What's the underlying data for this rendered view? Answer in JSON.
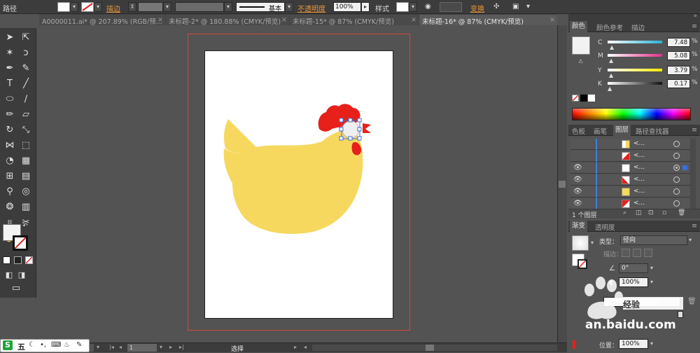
{
  "control_bar": {
    "selection_type": "路径",
    "stroke_label": "描边",
    "stroke_style": "基本",
    "opacity_label": "不透明度",
    "opacity_value": "100%",
    "style_label": "样式",
    "transform_label": "变换"
  },
  "tabs": [
    {
      "label": "A0000011.ai* @ 207.89% (RGB/预..."
    },
    {
      "label": "未标题-2* @ 180.88% (CMYK/预览)"
    },
    {
      "label": "未标题-15* @ 87% (CMYK/预览)"
    },
    {
      "label": "未标题-16* @ 87% (CMYK/预览)"
    }
  ],
  "color_panel": {
    "tabs": [
      "颜色",
      "颜色参考",
      "描边"
    ],
    "sliders": [
      {
        "label": "C",
        "value": "7.48",
        "unit": "%",
        "color": "#2ab3d8"
      },
      {
        "label": "M",
        "value": "5.08",
        "unit": "%",
        "color": "#e0308a"
      },
      {
        "label": "Y",
        "value": "3.79",
        "unit": "%",
        "color": "#f2e800"
      },
      {
        "label": "K",
        "value": "0.17",
        "unit": "%",
        "color": "#111111"
      }
    ]
  },
  "layers_panel": {
    "tabs": [
      "色板",
      "画笔",
      "图层",
      "路径查找器"
    ],
    "rows": [
      {
        "name": "<...",
        "thumb_color": "#f7d85e"
      },
      {
        "name": "<...",
        "thumb_color": "#e8201a"
      },
      {
        "name": "<...",
        "thumb_color": "#ffffff"
      },
      {
        "name": "<...",
        "thumb_color": "#e8201a"
      },
      {
        "name": "<...",
        "thumb_color": "#f7d85e"
      },
      {
        "name": "<...",
        "thumb_color": "#e8201a"
      }
    ],
    "footer": "1 个图层"
  },
  "gradient_panel": {
    "tabs": [
      "渐变",
      "透明度"
    ],
    "type_label": "类型：",
    "type_value": "径向",
    "stroke_label": "描边：",
    "angle_value": "0°",
    "aspect_value": "100%",
    "position_label": "位置：",
    "position_value": "100%"
  },
  "status": {
    "zoom": "87%",
    "page": "1",
    "tool": "选择"
  },
  "watermark": {
    "text": "an.baidu.com",
    "logo_text": "经验"
  },
  "ime": {
    "label": "五"
  }
}
